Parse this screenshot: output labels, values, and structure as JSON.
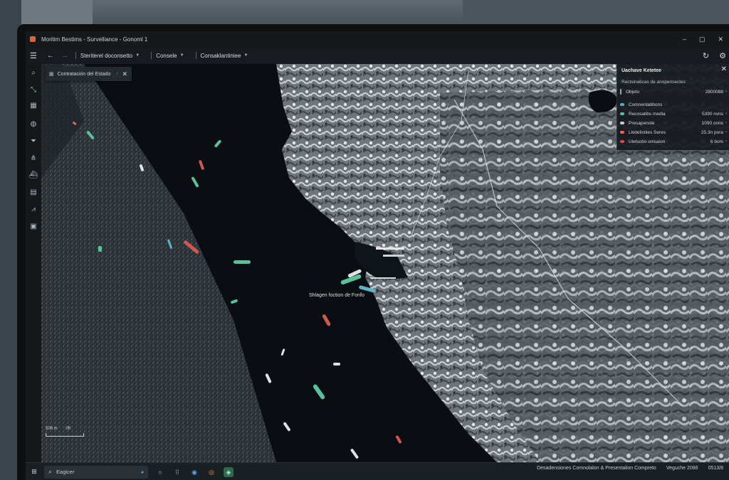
{
  "window": {
    "title": "Moritim Bestims - Survelliance - Gonoml 1",
    "controls": [
      "–",
      "▢",
      "✕"
    ]
  },
  "menubar": {
    "items": [
      {
        "label": "Steriterel doconsetto"
      },
      {
        "label": "Consele"
      },
      {
        "label": "Consaklantiniee"
      }
    ]
  },
  "search_chip": {
    "label": "Contratación del Estado"
  },
  "info_panel": {
    "title": "Uachave Ketetee",
    "subtitle": "Rectsinaticas de anopensectes",
    "rows": [
      {
        "label": "Objeto",
        "value": "2800088",
        "color": "#9aa7b0"
      },
      {
        "label": "Comnentatibons",
        "value": "",
        "color": "#4fb0c8"
      },
      {
        "label": "Recosatibs media",
        "value": "5390 nvns",
        "color": "#58c29a"
      },
      {
        "label": "Presapenste",
        "value": "1090 onns",
        "color": "#c8ccd0"
      },
      {
        "label": "Lkidelistiies Seres",
        "value": "25.3n pora",
        "color": "#e06a60"
      },
      {
        "label": "Uletsotio onisaion",
        "value": "6 bors",
        "color": "#e04848"
      }
    ]
  },
  "map": {
    "label": "Shlagen foction de Fonfo",
    "scale_label": "50ft m",
    "scale_unit": "0ft"
  },
  "taskbar": {
    "search_placeholder": "Eagicer",
    "tray_left": "Desadensiones Comnolalon & Presentalion Compreto",
    "tray_time": "Veguche 2086",
    "tray_date": "0513/8"
  },
  "colors": {
    "accent": "#58c29a",
    "alert": "#e0584e"
  }
}
